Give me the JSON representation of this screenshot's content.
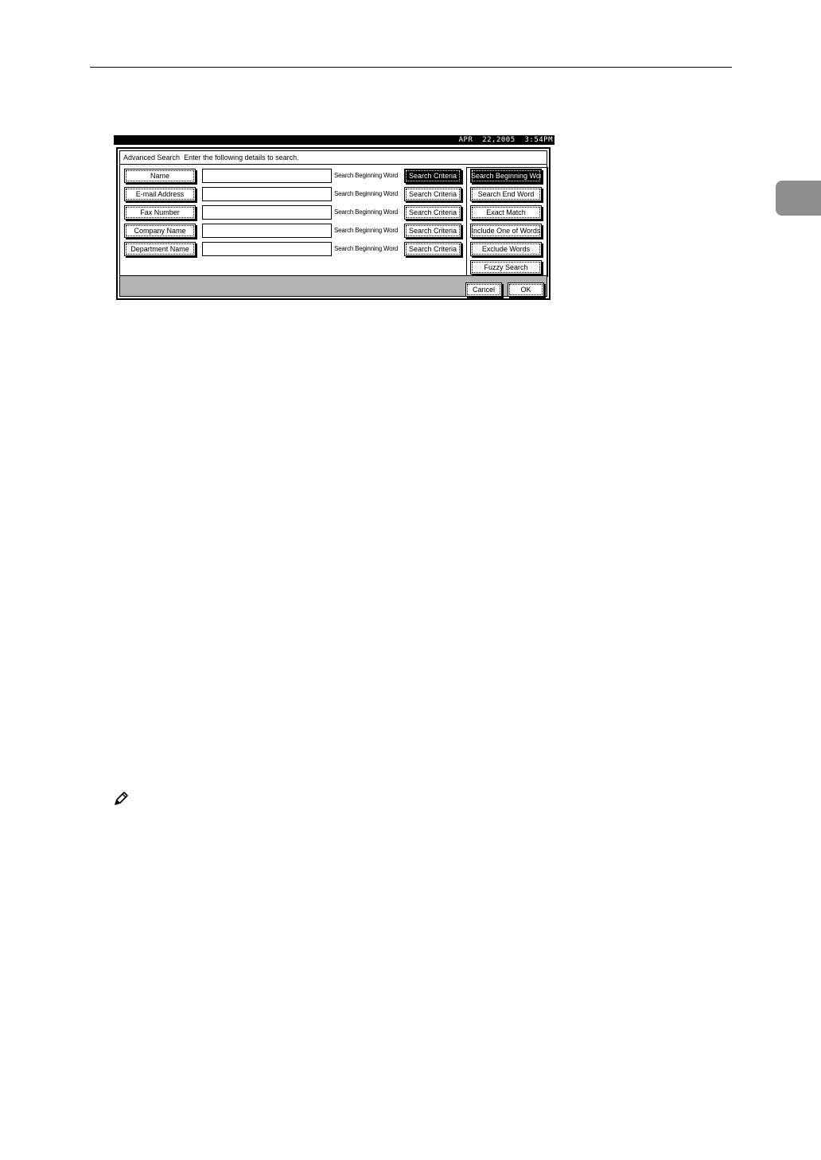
{
  "status": {
    "datetime": "APR  22,2005  3:54PM"
  },
  "dialog": {
    "title": "Advanced Search",
    "instruction": "Enter the following details to search."
  },
  "rows": [
    {
      "field_label": "Name",
      "value": "",
      "criteria_text": "Search Beginning Word",
      "criteria_button": "Search Criteria",
      "selected": true
    },
    {
      "field_label": "E-mail Address",
      "value": "",
      "criteria_text": "Search Beginning Word",
      "criteria_button": "Search Criteria",
      "selected": false
    },
    {
      "field_label": "Fax Number",
      "value": "",
      "criteria_text": "Search Beginning Word",
      "criteria_button": "Search Criteria",
      "selected": false
    },
    {
      "field_label": "Company Name",
      "value": "",
      "criteria_text": "Search Beginning Word",
      "criteria_button": "Search Criteria",
      "selected": false
    },
    {
      "field_label": "Department Name",
      "value": "",
      "criteria_text": "Search Beginning Word",
      "criteria_button": "Search Criteria",
      "selected": false
    }
  ],
  "criteria_options": [
    {
      "label": "Search Beginning Word",
      "selected": true
    },
    {
      "label": "Search End Word",
      "selected": false
    },
    {
      "label": "Exact Match",
      "selected": false
    },
    {
      "label": "Include One of Words",
      "selected": false
    },
    {
      "label": "Exclude Words",
      "selected": false
    },
    {
      "label": "Fuzzy Search",
      "selected": false
    }
  ],
  "footer": {
    "cancel_label": "Cancel",
    "ok_label": "OK"
  },
  "icons": {
    "note": "pencil-note-icon"
  },
  "colors": {
    "selected_bg": "#000000",
    "chapter_tab": "#8f8f8f"
  }
}
